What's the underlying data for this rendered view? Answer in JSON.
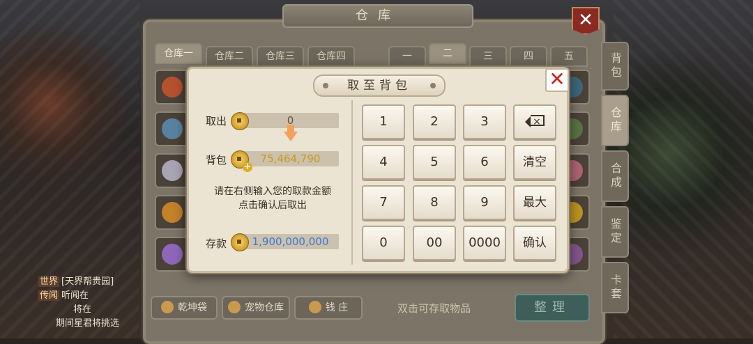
{
  "warehouse": {
    "title": "仓库",
    "close_icon": "close-icon",
    "left_tabs": [
      "仓库一",
      "仓库二",
      "仓库三",
      "仓库四"
    ],
    "right_tabs": [
      "一",
      "二",
      "三",
      "四",
      "五"
    ],
    "side_tabs": [
      "背包",
      "仓库",
      "合成",
      "鉴定",
      "卡套"
    ],
    "bottom_buttons": [
      "乾坤袋",
      "宠物仓库",
      "钱 庄"
    ],
    "hint": "双击可存取物品",
    "sort_label": "整理"
  },
  "chat": {
    "lines": [
      {
        "tag": "世界",
        "text": "[天界帮贵园]"
      },
      {
        "tag": "传闻",
        "text": "听闻在"
      },
      {
        "tag": "",
        "text": "将在"
      },
      {
        "tag": "",
        "text": "期间星君将挑选"
      }
    ]
  },
  "dialog": {
    "title": "取至背包",
    "close_icon": "close-icon",
    "withdraw_label": "取出",
    "withdraw_value": "0",
    "bag_label": "背包",
    "bag_value": "75,464,790",
    "notice_line1": "请在右侧输入您的取款金额",
    "notice_line2": "点击确认后取出",
    "deposit_label": "存款",
    "deposit_value": "1,900,000,000",
    "keypad": {
      "k1": "1",
      "k2": "2",
      "k3": "3",
      "k4": "4",
      "k5": "5",
      "k6": "6",
      "k7": "7",
      "k8": "8",
      "k9": "9",
      "k0": "0",
      "k00": "00",
      "k0000": "0000",
      "backspace_icon": "backspace-icon",
      "clear": "清空",
      "max": "最大",
      "confirm": "确认"
    },
    "colors": {
      "bag_value": "#c89a1d",
      "deposit_value": "#3d78d8",
      "close": "#c4261d"
    }
  }
}
